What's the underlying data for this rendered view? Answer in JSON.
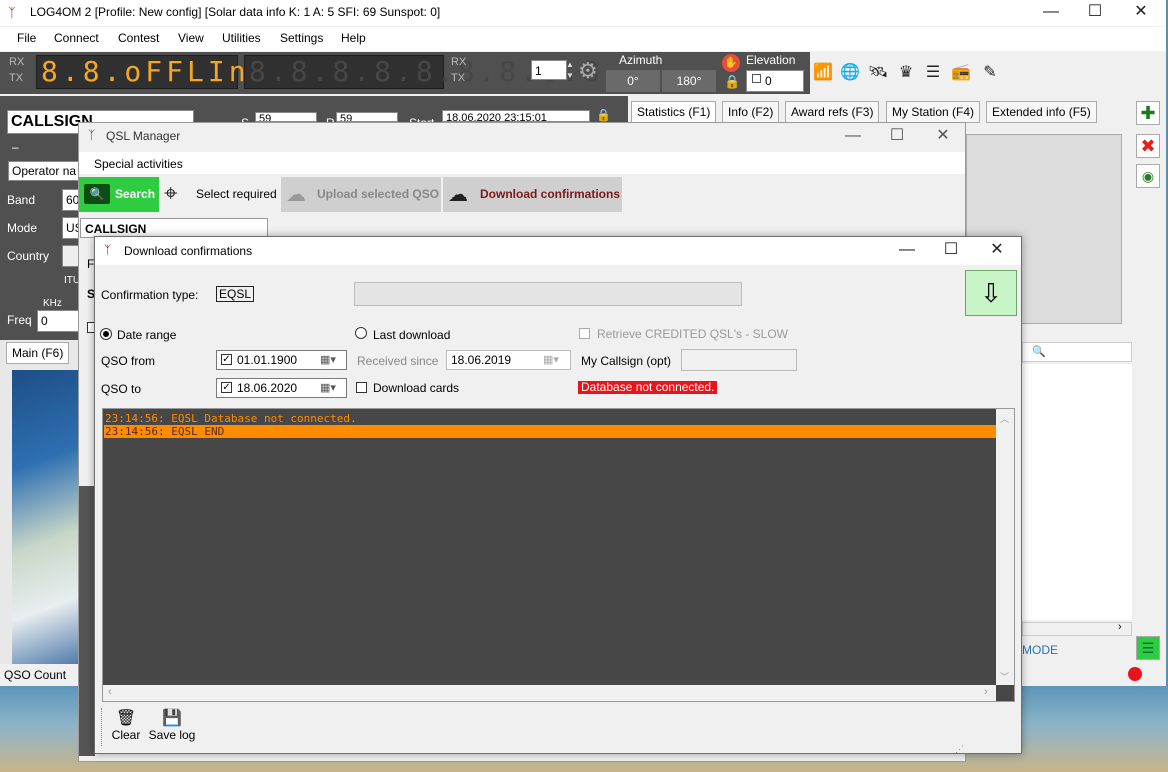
{
  "app": {
    "title": "LOG4OM 2 [Profile: New config] [Solar data info K: 1 A: 5 SFI: 69 Sunspot: 0]",
    "window_controls": {
      "minimize": "—",
      "maximize": "☐",
      "close": "✕"
    }
  },
  "menu": [
    "File",
    "Connect",
    "Contest",
    "View",
    "Utilities",
    "Settings",
    "Help"
  ],
  "radio_panel": {
    "rx": "RX",
    "tx": "TX",
    "display_left": "8.8.oFFLInE",
    "display_right": "8.8.8.8.8.8.8.8.8",
    "spin_value": "1",
    "azimuth_label": "Azimuth",
    "azimuth_values": [
      "0°",
      "180°"
    ],
    "elevation_label": "Elevation",
    "elevation_value": "0"
  },
  "qso_entry": {
    "callsign": "CALLSIGN",
    "operator_placeholder": "Operator na",
    "labels": {
      "band": "Band",
      "mode": "Mode",
      "country": "Country",
      "itu": "ITU",
      "khz": "KHz",
      "freq": "Freq"
    },
    "band_value": "60",
    "mode_value": "US",
    "freq_value": "0",
    "dash": "–",
    "s_label": "S",
    "s_value": "59",
    "r_label": "R",
    "r_value": "59",
    "start_label": "Start",
    "start_value": "18.06.2020 23:15:01",
    "main_tab": "Main (F6)",
    "qso_count": "QSO Count"
  },
  "info_tabs": [
    "Statistics (F1)",
    "Info (F2)",
    "Award refs (F3)",
    "My Station (F4)",
    "Extended info (F5)"
  ],
  "status_mode": "MODE",
  "qsl_manager": {
    "title": "QSL Manager",
    "menu": "Special activities",
    "toolbar": {
      "search": "Search",
      "select_required": "Select required",
      "upload_selected": "Upload selected QSO",
      "download_confirmations": "Download confirmations"
    },
    "callsign_header": "CALLSIGN",
    "partial_f": "F",
    "partial_s": "S"
  },
  "download_dialog": {
    "title": "Download confirmations",
    "confirmation_type_label": "Confirmation type:",
    "confirmation_type_value": "EQSL",
    "date_range_label": "Date range",
    "last_download_label": "Last download",
    "retrieve_credited_label": "Retrieve CREDITED QSL's - SLOW",
    "qso_from_label": "QSO from",
    "qso_from_value": "01.01.1900",
    "qso_to_label": "QSO to",
    "qso_to_value": "18.06.2020",
    "received_since_label": "Received since",
    "received_since_value": "18.06.2019",
    "my_callsign_label": "My Callsign (opt)",
    "my_callsign_value": "",
    "download_cards_label": "Download cards",
    "db_status": "Database not connected.",
    "log_lines": [
      "23:14:56: EQSL Database not connected.",
      "23:14:56: EQSL END"
    ],
    "clear_label": "Clear",
    "save_log_label": "Save log"
  },
  "colors": {
    "search_green": "#2ecc40",
    "log_orange": "#ff8c00",
    "error_red": "#e8141c",
    "log_bg": "#474747",
    "segment_amber": "#f5a623"
  }
}
